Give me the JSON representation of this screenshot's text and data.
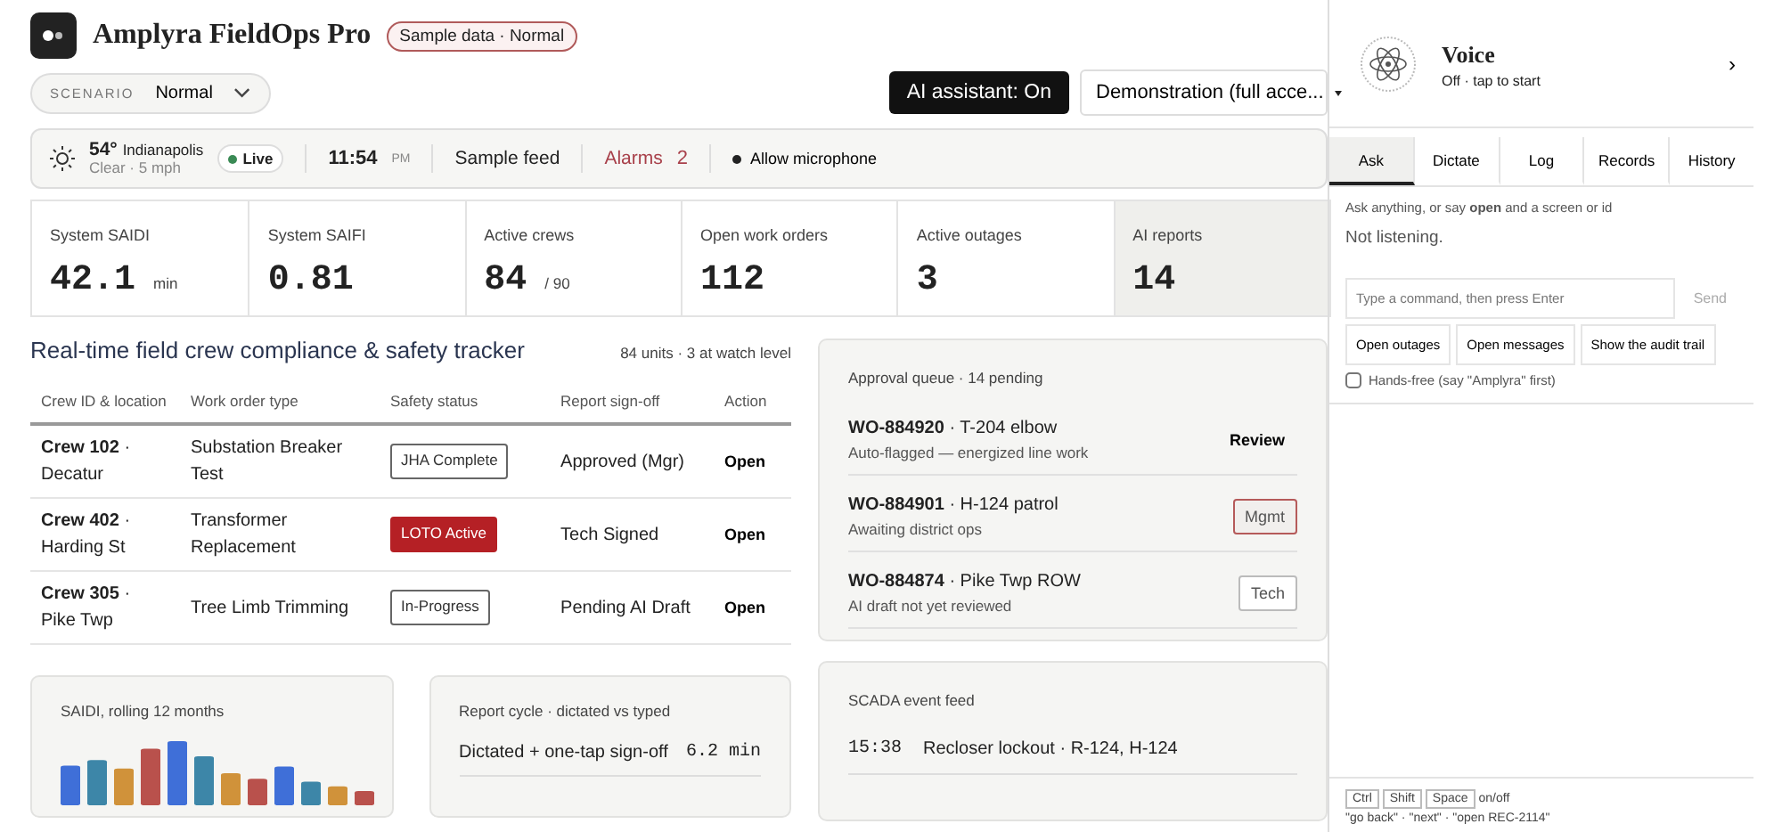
{
  "app": {
    "title": "Amplyra FieldOps Pro",
    "badge": "Sample data · Normal"
  },
  "scenario": {
    "label": "SCENARIO",
    "value": "Normal"
  },
  "assistant_button": {
    "label": "AI assistant: On",
    "on": true
  },
  "mode_select": {
    "value": "Demonstration (full acce..."
  },
  "status_bar": {
    "temp": "54°",
    "city": "Indianapolis",
    "conditions": "Clear · 5 mph",
    "live": "Live",
    "time": "11:54",
    "ampm": "PM",
    "feed": "Sample feed",
    "alarms_label": "Alarms",
    "alarms_count": "2",
    "microphone": "Allow microphone"
  },
  "kpis": [
    {
      "label": "System SAIDI",
      "value": "42.1",
      "unit": "min",
      "selected": false
    },
    {
      "label": "System SAIFI",
      "value": "0.81",
      "selected": false
    },
    {
      "label": "Active crews",
      "value": "84",
      "unit": "/ 90",
      "selected": false
    },
    {
      "label": "Open work orders",
      "value": "112",
      "selected": false
    },
    {
      "label": "Active outages",
      "value": "3",
      "selected": false
    },
    {
      "label": "AI reports",
      "value": "14",
      "selected": true
    }
  ],
  "tracker": {
    "title": "Real-time field crew compliance & safety tracker",
    "summary": "84 units · 3 at watch level",
    "columns": [
      "Crew ID & location",
      "Work order type",
      "Safety status",
      "Report sign-off",
      "Action"
    ],
    "rows": [
      {
        "crew": "**Crew 102** · Decatur",
        "type": "Substation Breaker Test",
        "status": {
          "text": "JHA Complete",
          "kind": "outline"
        },
        "signoff": "Approved (Mgr)",
        "action": "Open"
      },
      {
        "crew": "**Crew 402** · Harding St",
        "type": "Transformer Replacement",
        "status": {
          "text": "LOTO Active",
          "kind": "alert"
        },
        "signoff": "Tech Signed",
        "action": "Open"
      },
      {
        "crew": "**Crew 305** · Pike Twp",
        "type": "Tree Limb Trimming",
        "status": {
          "text": "In-Progress",
          "kind": "outline"
        },
        "signoff": "Pending AI Draft",
        "action": "Open"
      }
    ]
  },
  "approval_queue": {
    "title": "Approval queue · 14 pending",
    "items": [
      {
        "title": "**WO-884920** · T-204 elbow",
        "note": "Auto-flagged — energized line work",
        "action": "Review",
        "kind": "plain"
      },
      {
        "title": "**WO-884901** · H-124 patrol",
        "note": "Awaiting district ops",
        "action": "Mgmt",
        "kind": "flagged"
      },
      {
        "title": "**WO-884874** · Pike Twp ROW",
        "note": "AI draft not yet reviewed",
        "action": "Tech",
        "kind": "outline"
      }
    ]
  },
  "saidi_card": {
    "title": "SAIDI, rolling 12 months"
  },
  "report_cycle": {
    "title": "Report cycle · dictated vs typed",
    "rows": [
      {
        "label": "Dictated + one-tap sign-off",
        "value": "6.2 min"
      }
    ]
  },
  "scada": {
    "title": "SCADA event feed",
    "events": [
      {
        "time": "15:38",
        "text": "Recloser lockout · R-124, H-124"
      }
    ]
  },
  "voice": {
    "title": "Voice",
    "subtitle": "Off · tap to start",
    "chevron": "›",
    "tabs": [
      {
        "label": "Ask",
        "selected": true
      },
      {
        "label": "Dictate",
        "selected": false
      },
      {
        "label": "Log",
        "selected": false
      },
      {
        "label": "Records",
        "selected": false
      },
      {
        "label": "History",
        "selected": false
      }
    ],
    "hint": "Ask anything, or say **open** and a screen or id",
    "state": "Not listening.",
    "command": {
      "placeholder": "Type a command, then press Enter",
      "send": "Send"
    },
    "quick": [
      "Open outages",
      "Open messages",
      "Show the audit trail"
    ],
    "hands_free": {
      "label": "Hands-free (say \"Amplyra\" first)",
      "checked": false
    },
    "keys": [
      "Ctrl",
      "Shift",
      "Space"
    ],
    "keys_note": "on/off",
    "examples": "\"go back\" · \"next\" · \"open REC-2114\""
  }
}
